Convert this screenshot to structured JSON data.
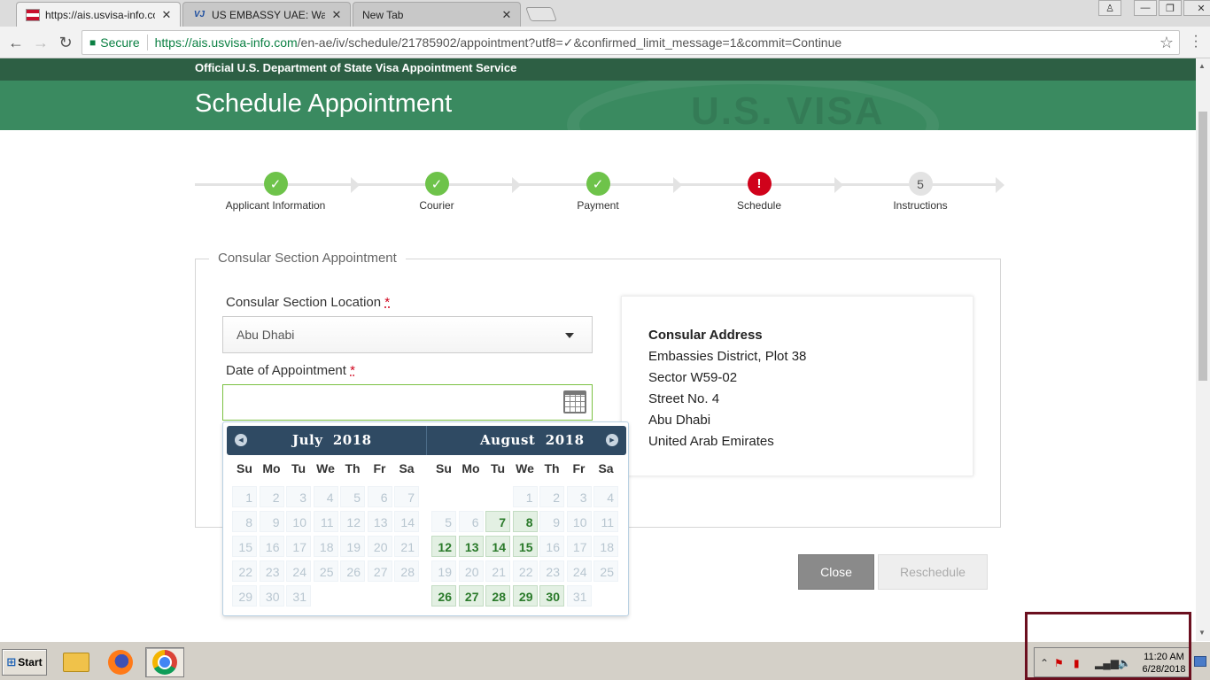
{
  "browser": {
    "tabs": [
      {
        "title": "https://ais.usvisa-info.com/",
        "active": true
      },
      {
        "title": "US EMBASSY UAE: Waiting",
        "active": false
      },
      {
        "title": "New Tab",
        "active": false
      }
    ],
    "security_label": "Secure",
    "url_host": "https://ais.usvisa-info.com",
    "url_rest": "/en-ae/iv/schedule/21785902/appointment?utf8=✓&confirmed_limit_message=1&commit=Continue"
  },
  "header": {
    "top_text": "Official U.S. Department of State Visa Appointment Service",
    "title": "Schedule Appointment",
    "seal_text": "U.S. VISA"
  },
  "steps": [
    {
      "label": "Applicant Information",
      "status": "done",
      "marker": "✓"
    },
    {
      "label": "Courier",
      "status": "done",
      "marker": "✓"
    },
    {
      "label": "Payment",
      "status": "done",
      "marker": "✓"
    },
    {
      "label": "Schedule",
      "status": "error",
      "marker": "!"
    },
    {
      "label": "Instructions",
      "status": "pending",
      "marker": "5"
    }
  ],
  "form": {
    "legend": "Consular Section Appointment",
    "location_label": "Consular Section Location",
    "required_mark": "*",
    "location_value": "Abu Dhabi",
    "date_label": "Date of Appointment",
    "date_value": ""
  },
  "address": {
    "title": "Consular Address",
    "lines": [
      "Embassies District, Plot 38",
      "Sector W59-02",
      "Street No. 4",
      "Abu Dhabi",
      "United Arab Emirates"
    ]
  },
  "buttons": {
    "close": "Close",
    "reschedule": "Reschedule"
  },
  "datepicker": {
    "weekdays": [
      "Su",
      "Mo",
      "Tu",
      "We",
      "Th",
      "Fr",
      "Sa"
    ],
    "months": [
      {
        "title": "July",
        "year": "2018",
        "first_weekday": 0,
        "days": 31,
        "available": []
      },
      {
        "title": "August",
        "year": "2018",
        "first_weekday": 3,
        "days": 31,
        "available": [
          7,
          8,
          12,
          13,
          14,
          15,
          26,
          27,
          28,
          29,
          30
        ]
      }
    ]
  },
  "taskbar": {
    "start": "Start",
    "time": "11:20 AM",
    "date": "6/28/2018"
  },
  "colors": {
    "header_dark": "#2d5f44",
    "header": "#3a8a60",
    "step_done": "#6ec34a",
    "step_error": "#d0021b",
    "available_day": "#2a7a2a"
  }
}
